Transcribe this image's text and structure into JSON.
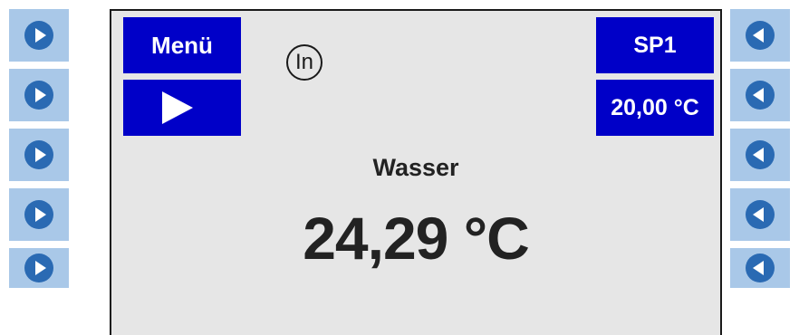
{
  "left_buttons": [
    "play-icon",
    "play-icon",
    "play-icon",
    "play-icon",
    "play-icon"
  ],
  "right_buttons": [
    "back-icon",
    "back-icon",
    "back-icon",
    "back-icon",
    "back-icon"
  ],
  "display": {
    "menu_label": "Menü",
    "start_icon": "play-triangle-icon",
    "input_indicator": "In",
    "setpoint_label": "SP1",
    "setpoint_value": "20,00 °C",
    "medium_label": "Wasser",
    "temperature": "24,29 °C"
  },
  "colors": {
    "side_button": "#a9c8e8",
    "side_icon": "#2a6ab3",
    "screen_button": "#0000c8",
    "screen_background": "#e6e6e6"
  }
}
